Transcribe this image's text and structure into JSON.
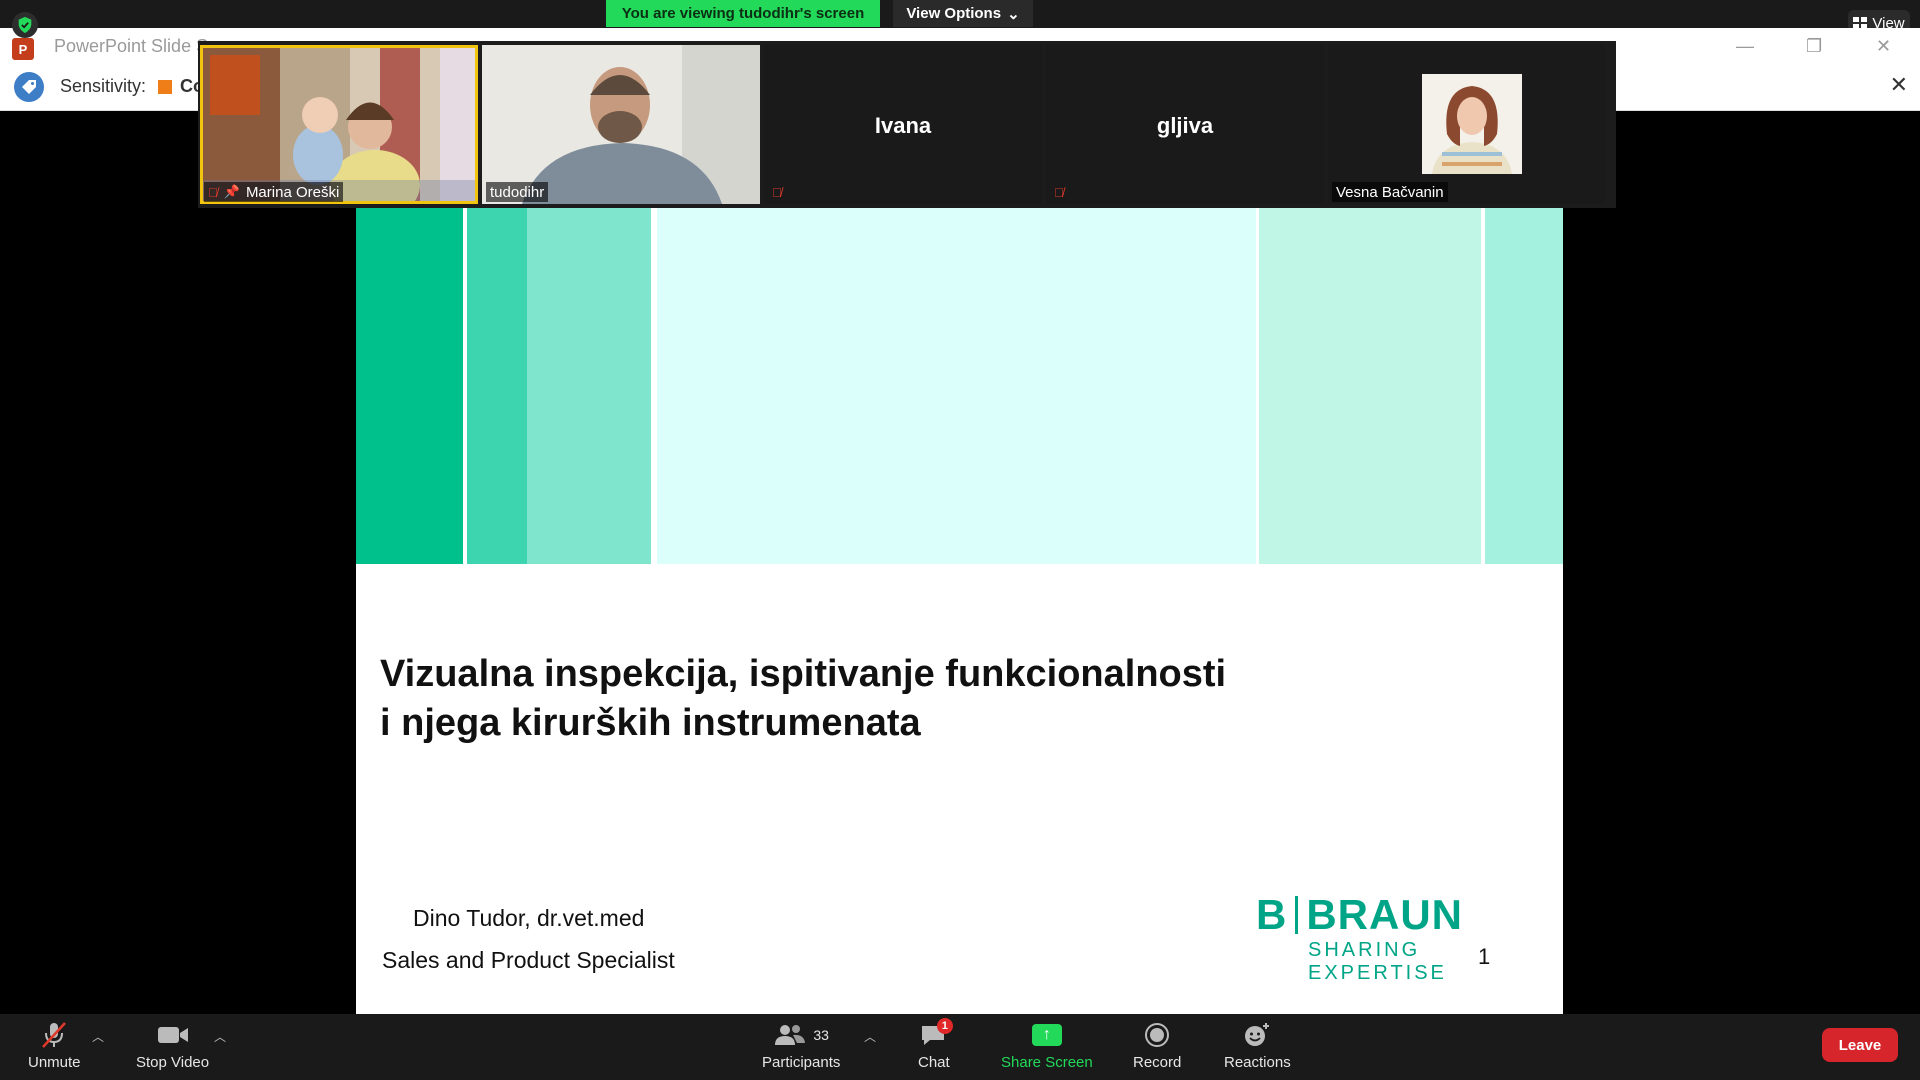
{
  "banner": {
    "viewing": "You are viewing tudodihr's screen",
    "view_options": "View Options",
    "view": "View"
  },
  "ppt": {
    "logo_letter": "P",
    "title": "PowerPoint Slide S",
    "minimize": "—",
    "restore": "❐",
    "close": "✕"
  },
  "sensitivity": {
    "label": "Sensitivity:",
    "value": "Co",
    "close": "✕"
  },
  "participants_strip": [
    {
      "name": "Marina Oreški",
      "kind": "video",
      "muted": true,
      "pinned": true
    },
    {
      "name": "tudodihr",
      "kind": "video",
      "muted": false,
      "speaking": true
    },
    {
      "name": "Ivana",
      "kind": "name-only",
      "muted": true
    },
    {
      "name": "gljiva",
      "kind": "name-only",
      "muted": true
    },
    {
      "name": "Vesna Bačvanin",
      "kind": "avatar",
      "muted": false
    }
  ],
  "slide": {
    "title_line1": "Vizualna inspekcija, ispitivanje funkcionalnosti",
    "title_line2": "i njega kirurških instrumenata",
    "presenter": "Dino Tudor, dr.vet.med",
    "role": "Sales and Product Specialist",
    "logo_left": "B",
    "logo_right": "BRAUN",
    "logo_tagline": "SHARING EXPERTISE",
    "page_number": "1",
    "band_colors": [
      "#00c08b",
      "#ffffff",
      "#3dd5b0",
      "#7fe5cd",
      "#ffffff",
      "#dbfffa",
      "#ffffff",
      "#bff6e5",
      "#ffffff",
      "#a3f1de"
    ]
  },
  "toolbar": {
    "unmute": "Unmute",
    "stop_video": "Stop Video",
    "participants": "Participants",
    "participants_count": "33",
    "chat": "Chat",
    "chat_badge": "1",
    "share_screen": "Share Screen",
    "record": "Record",
    "reactions": "Reactions",
    "leave": "Leave"
  },
  "colors": {
    "accent_green": "#23d959",
    "leave_red": "#d6262c",
    "braun_green": "#00a587"
  }
}
